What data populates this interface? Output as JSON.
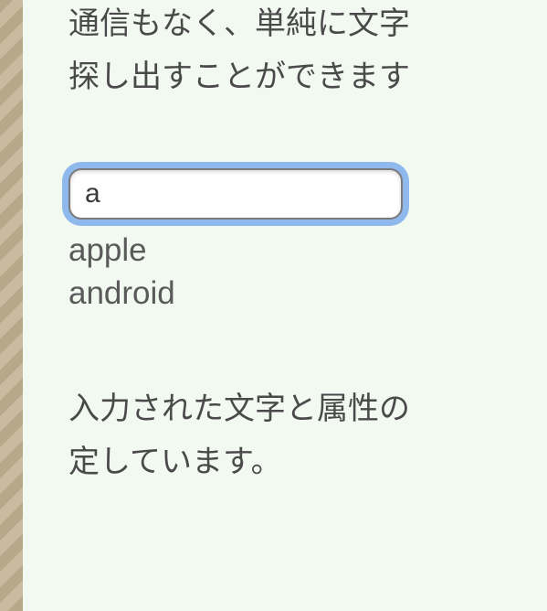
{
  "paragraph": {
    "top_line1": "通信もなく、単純に文字",
    "top_line2": "探し出すことができます",
    "bottom_line1": "入力された文字と属性の",
    "bottom_line2": "定しています。"
  },
  "search": {
    "value": "a"
  },
  "suggestions": {
    "items": [
      "apple",
      "android"
    ]
  }
}
